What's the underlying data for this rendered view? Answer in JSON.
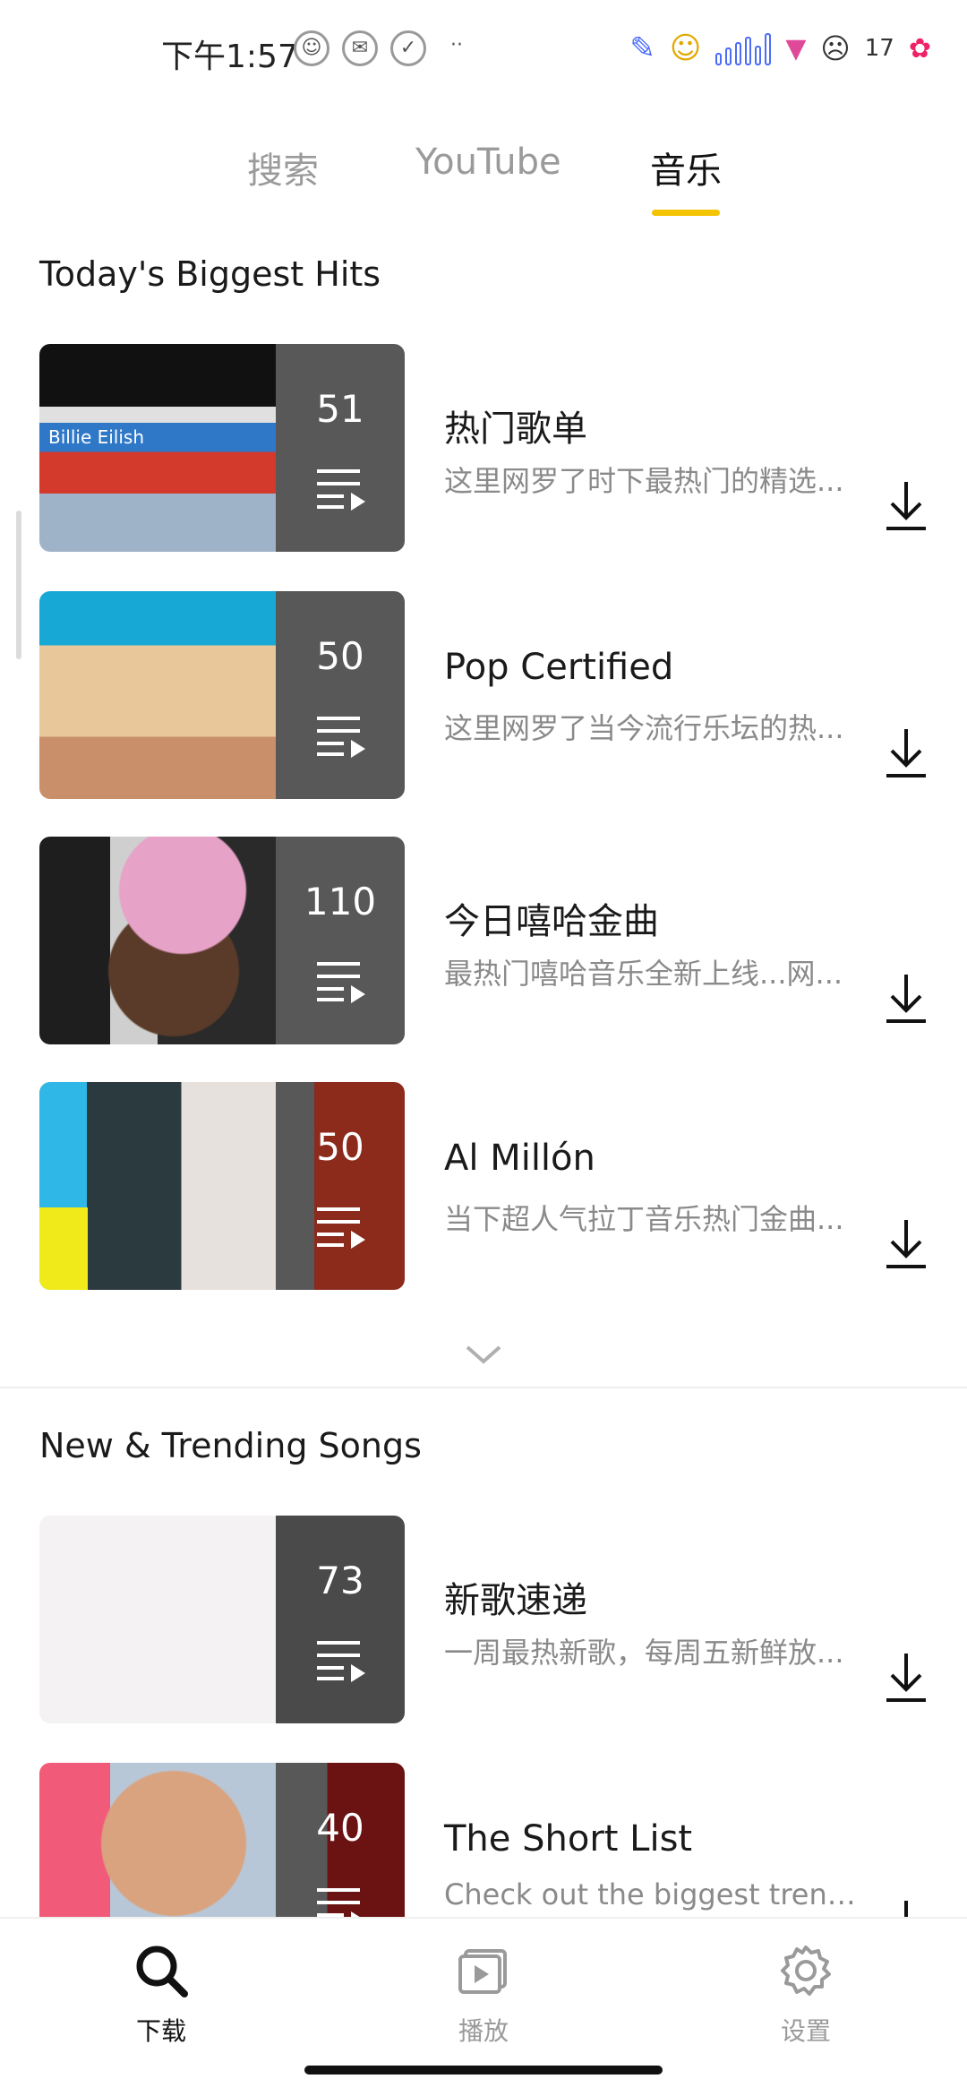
{
  "status_bar": {
    "time": "下午1:57",
    "notification_count": "17"
  },
  "tabs": [
    {
      "label": "搜索",
      "active": false
    },
    {
      "label": "YouTube",
      "active": false
    },
    {
      "label": "音乐",
      "active": true
    }
  ],
  "sections": [
    {
      "title": "Today's Biggest Hits",
      "items": [
        {
          "title": "热门歌单",
          "desc": "这里网罗了时下最热门的精选...",
          "count": "51",
          "cover_label": "Billie Eilish",
          "cover_colors": [
            "#c9c9c9",
            "#d33a2c"
          ]
        },
        {
          "title": "Pop Certified",
          "desc": "这里网罗了当今流行乐坛的热...",
          "count": "50",
          "cover_colors": [
            "#17a8d6",
            "#e8c79a"
          ]
        },
        {
          "title": "今日嘻哈金曲",
          "desc": "最热门嘻哈音乐全新上线...网...",
          "count": "110",
          "cover_colors": [
            "#2a2a2a",
            "#e7a2c8"
          ]
        },
        {
          "title": "Al Millón",
          "desc": "当下超人气拉丁音乐热门金曲...",
          "count": "50",
          "cover_colors": [
            "#2fb7e8",
            "#f1ea1b"
          ]
        }
      ]
    },
    {
      "title": "New & Trending Songs",
      "items": [
        {
          "title": "新歌速递",
          "desc": "一周最热新歌，每周五新鲜放...",
          "count": "73",
          "cover_colors": [
            "#f5f2f3",
            "#f5f2f3"
          ]
        },
        {
          "title": "The Short List",
          "desc": "Check out the biggest trend...",
          "count": "40",
          "cover_colors": [
            "#f15a78",
            "#d9a37f"
          ]
        }
      ]
    }
  ],
  "bottom_nav": [
    {
      "label": "下载",
      "icon": "search-icon",
      "active": true
    },
    {
      "label": "播放",
      "icon": "video-play-icon",
      "active": false
    },
    {
      "label": "设置",
      "icon": "gear-icon",
      "active": false
    }
  ],
  "colors": {
    "accent": "#f5c400",
    "active_text": "#111111",
    "inactive_text": "#9a9a9a"
  }
}
